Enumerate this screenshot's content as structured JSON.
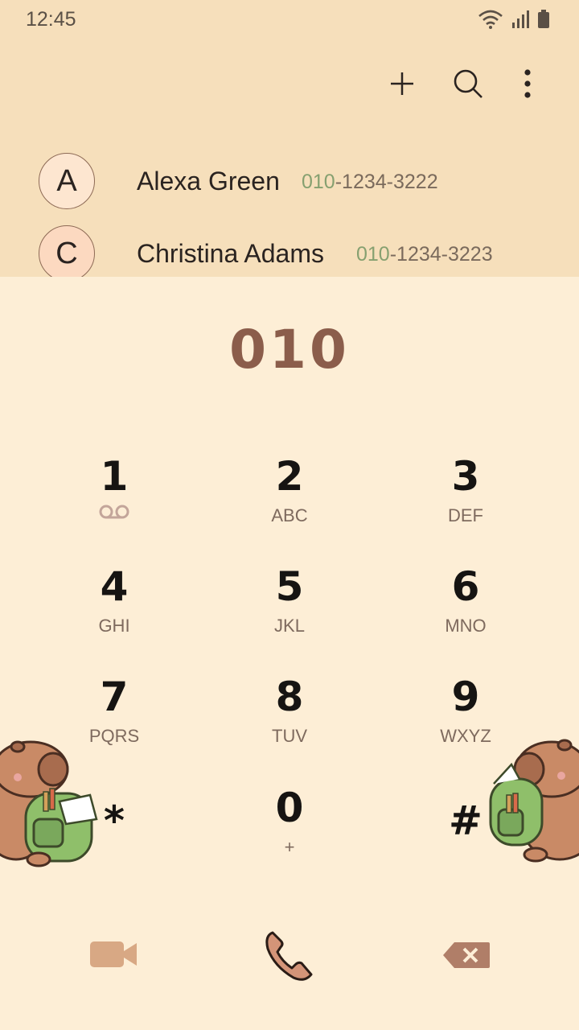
{
  "status_bar": {
    "time": "12:45"
  },
  "toolbar": {
    "add_icon": "plus-icon",
    "search_icon": "search-icon",
    "more_icon": "more-vert-icon"
  },
  "suggestions": [
    {
      "initial": "A",
      "name": "Alexa Green",
      "number_match": "010",
      "number_rest": "-1234-3222",
      "avatar_color": "#fde6d0"
    },
    {
      "initial": "C",
      "name": "Christina Adams",
      "number_match": "010",
      "number_rest": "-1234-3223",
      "avatar_color": "#fcd9c0"
    }
  ],
  "dialer": {
    "input": "010"
  },
  "keypad": [
    {
      "digit": "1",
      "letters": ""
    },
    {
      "digit": "2",
      "letters": "ABC"
    },
    {
      "digit": "3",
      "letters": "DEF"
    },
    {
      "digit": "4",
      "letters": "GHI"
    },
    {
      "digit": "5",
      "letters": "JKL"
    },
    {
      "digit": "6",
      "letters": "MNO"
    },
    {
      "digit": "7",
      "letters": "PQRS"
    },
    {
      "digit": "8",
      "letters": "TUV"
    },
    {
      "digit": "9",
      "letters": "WXYZ"
    },
    {
      "digit": "*",
      "letters": ""
    },
    {
      "digit": "0",
      "letters": "+"
    },
    {
      "digit": "#",
      "letters": ""
    }
  ],
  "colors": {
    "top_bg": "#f6dfbb",
    "pad_bg": "#fdeed6",
    "accent": "#8b5d4b",
    "match": "#86a070"
  }
}
